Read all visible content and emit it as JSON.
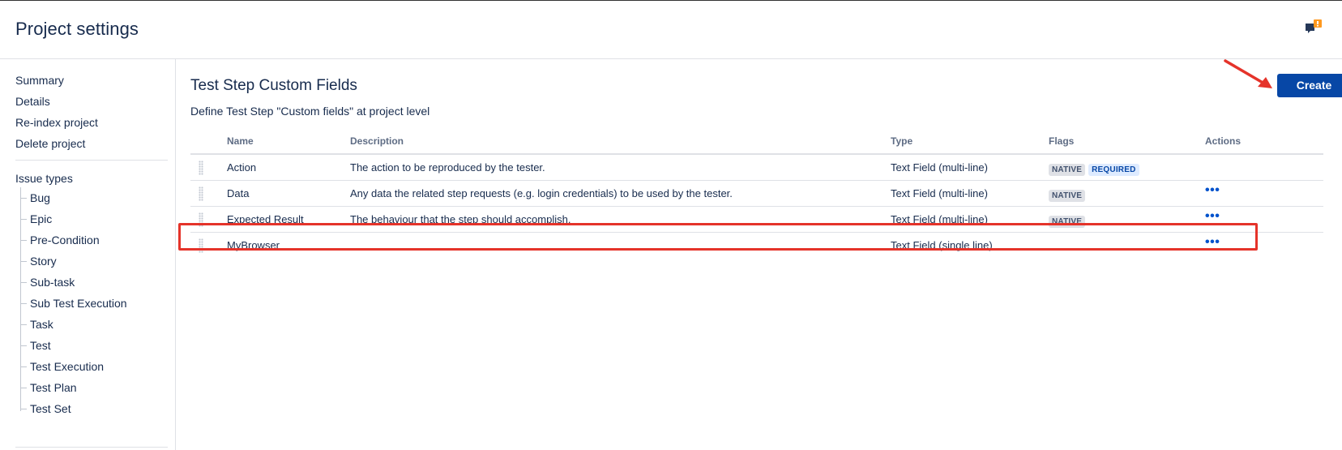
{
  "header": {
    "title": "Project settings",
    "feedback_icon": "feedback-icon"
  },
  "sidebar": {
    "links": [
      "Summary",
      "Details",
      "Re-index project",
      "Delete project"
    ],
    "issue_types_heading": "Issue types",
    "issue_types": [
      "Bug",
      "Epic",
      "Pre-Condition",
      "Story",
      "Sub-task",
      "Sub Test Execution",
      "Task",
      "Test",
      "Test Execution",
      "Test Plan",
      "Test Set"
    ]
  },
  "main": {
    "title": "Test Step Custom Fields",
    "description": "Define Test Step \"Custom fields\" at project level",
    "create_label": "Create",
    "table": {
      "columns": [
        "Name",
        "Description",
        "Type",
        "Flags",
        "Actions"
      ],
      "rows": [
        {
          "name": "Action",
          "description": "The action to be reproduced by the tester.",
          "type": "Text Field (multi-line)",
          "flags": [
            "NATIVE",
            "REQUIRED"
          ],
          "actions": ""
        },
        {
          "name": "Data",
          "description": "Any data the related step requests (e.g. login credentials) to be used by the tester.",
          "type": "Text Field (multi-line)",
          "flags": [
            "NATIVE"
          ],
          "actions": "•••"
        },
        {
          "name": "Expected Result",
          "description": "The behaviour that the step should accomplish.",
          "type": "Text Field (multi-line)",
          "flags": [
            "NATIVE"
          ],
          "actions": "•••"
        },
        {
          "name": "MyBrowser",
          "description": "",
          "type": "Text Field (single line)",
          "flags": [],
          "actions": "•••"
        }
      ]
    }
  },
  "colors": {
    "primary": "#0747a6",
    "annotation": "#e5332a",
    "native_badge_bg": "#dfe1e6",
    "required_badge_bg": "#deebff"
  }
}
